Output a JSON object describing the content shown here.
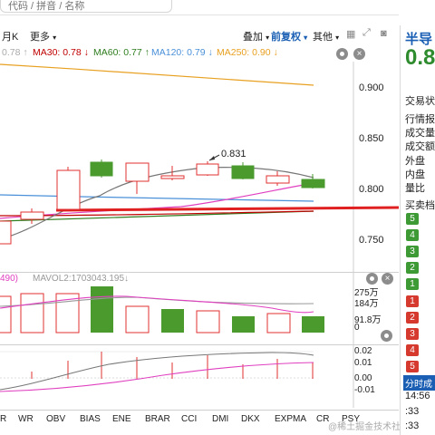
{
  "search": {
    "placeholder": "代码 / 拼音 / 名称"
  },
  "toolbar": {
    "period": "月K",
    "more": "更多",
    "overlay": "叠加",
    "adjust": "前复权",
    "other": "其他"
  },
  "legend": {
    "items": [
      {
        "text": "0.78 ↑",
        "color": "#aaaaaa"
      },
      {
        "text": "MA30: 0.78 ↓",
        "color": "#c00000"
      },
      {
        "text": "MA60: 0.77 ↑",
        "color": "#2e7d1e"
      },
      {
        "text": "MA120: 0.79 ↓",
        "color": "#4a90d9"
      },
      {
        "text": "MA250: 0.90 ↓",
        "color": "#e8a020"
      }
    ]
  },
  "price_axis": {
    "ticks": [
      "0.900",
      "0.850",
      "0.800",
      "0.750"
    ]
  },
  "annotation": {
    "text": "0.831"
  },
  "volume": {
    "label_left": "490)",
    "label_mavol2": "MAVOL2:1703043.195↓",
    "ticks": [
      "275万",
      "184万",
      "91.8万",
      "0"
    ]
  },
  "indicator": {
    "ticks": [
      "0.02",
      "0.01",
      "0.00",
      "-0.01"
    ]
  },
  "bottom_tabs": [
    "R",
    "WR",
    "OBV",
    "BIAS",
    "ENE",
    "BRAR",
    "CCI",
    "DMI",
    "DKX",
    "EXPMA",
    "CR",
    "PSY"
  ],
  "watermark": "@稀土掘金技术社区",
  "colors": {
    "up": "#e03030",
    "down": "#4a9a2e",
    "accent_blue": "#1a5fb4",
    "title_blue": "#1a5fb4"
  },
  "right_panel": {
    "title": "半导",
    "price": "0.8",
    "rows": [
      "交易状",
      "行情报",
      "成交量",
      "成交额",
      "外盘",
      "内盘",
      "量比",
      "买卖档"
    ],
    "green_badges": [
      "5",
      "4",
      "3",
      "2",
      "1"
    ],
    "red_badges": [
      "1",
      "2",
      "3",
      "4",
      "5"
    ],
    "time_section": "分时成",
    "times": [
      "14:56",
      ":33",
      ":33"
    ]
  }
}
